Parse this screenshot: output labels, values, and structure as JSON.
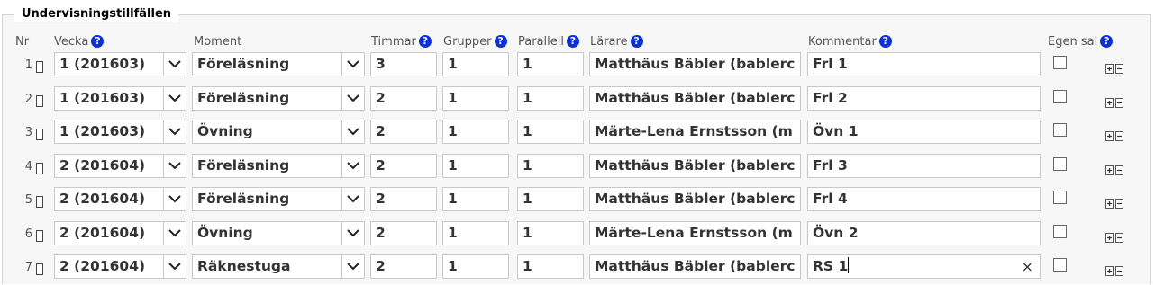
{
  "legend": "Undervisningstillfällen",
  "help_symbol": "?",
  "headers": {
    "nr": "Nr",
    "vecka": "Vecka",
    "moment": "Moment",
    "timmar": "Timmar",
    "grupper": "Grupper",
    "parallell": "Parallell",
    "larare": "Lärare",
    "kommentar": "Kommentar",
    "egen_sal": "Egen sal"
  },
  "rows": [
    {
      "nr": "1",
      "vecka": "1 (201603)",
      "moment": "Föreläsning",
      "timmar": "3",
      "grupper": "1",
      "parallell": "1",
      "larare": "Matthäus Bäbler (bablerc",
      "kommentar": "Frl 1",
      "egen_sal": false
    },
    {
      "nr": "2",
      "vecka": "1 (201603)",
      "moment": "Föreläsning",
      "timmar": "2",
      "grupper": "1",
      "parallell": "1",
      "larare": "Matthäus Bäbler (bablerc",
      "kommentar": "Frl 2",
      "egen_sal": false
    },
    {
      "nr": "3",
      "vecka": "1 (201603)",
      "moment": "Övning",
      "timmar": "2",
      "grupper": "1",
      "parallell": "1",
      "larare": "Märte-Lena Ernstsson (m",
      "kommentar": "Övn 1",
      "egen_sal": false
    },
    {
      "nr": "4",
      "vecka": "2 (201604)",
      "moment": "Föreläsning",
      "timmar": "2",
      "grupper": "1",
      "parallell": "1",
      "larare": "Matthäus Bäbler (bablerc",
      "kommentar": "Frl 3",
      "egen_sal": false
    },
    {
      "nr": "5",
      "vecka": "2 (201604)",
      "moment": "Föreläsning",
      "timmar": "2",
      "grupper": "1",
      "parallell": "1",
      "larare": "Matthäus Bäbler (bablerc",
      "kommentar": "Frl 4",
      "egen_sal": false
    },
    {
      "nr": "6",
      "vecka": "2 (201604)",
      "moment": "Övning",
      "timmar": "2",
      "grupper": "1",
      "parallell": "1",
      "larare": "Märte-Lena Ernstsson (m",
      "kommentar": "Övn 2",
      "egen_sal": false
    },
    {
      "nr": "7",
      "vecka": "2 (201604)",
      "moment": "Räknestuga",
      "timmar": "2",
      "grupper": "1",
      "parallell": "1",
      "larare": "Matthäus Bäbler (bablerc",
      "kommentar": "RS 1",
      "egen_sal": false
    }
  ],
  "focused_row": 6,
  "clear_symbol": "×",
  "icons": {
    "drag": "drag-handle-icon",
    "add": "plus-icon",
    "remove": "minus-icon",
    "dropdown": "chevron-down-icon",
    "help": "help-icon"
  },
  "colors": {
    "help_badge": "#0a2fe0",
    "panel_background": "#f7f7f7",
    "input_border": "#c9c9c9"
  }
}
